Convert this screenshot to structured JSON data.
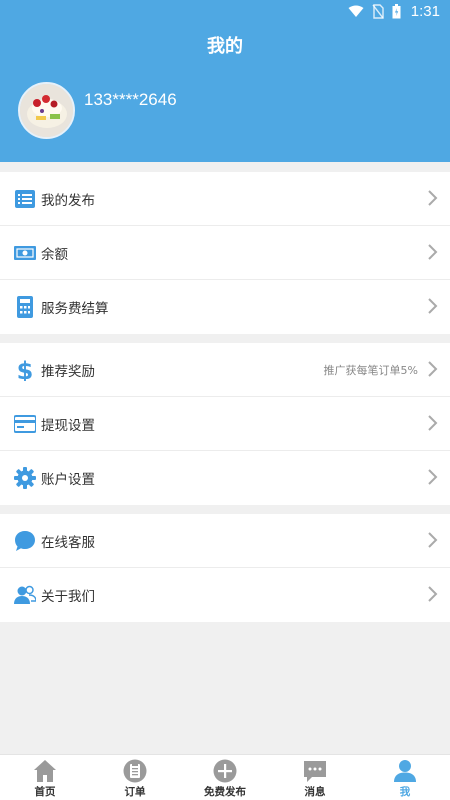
{
  "status_bar": {
    "time": "1:31"
  },
  "header": {
    "title": "我的",
    "phone": "133****2646"
  },
  "colors": {
    "primary": "#4fa8e3",
    "icon_blue": "#3f9ae0"
  },
  "groups": [
    {
      "items": [
        {
          "label": "我的发布",
          "icon": "list-icon"
        },
        {
          "label": "余额",
          "icon": "money-icon"
        },
        {
          "label": "服务费结算",
          "icon": "calculator-icon"
        }
      ]
    },
    {
      "items": [
        {
          "label": "推荐奖励",
          "icon": "dollar-icon",
          "hint": "推广获每笔订单5%"
        },
        {
          "label": "提现设置",
          "icon": "card-icon"
        },
        {
          "label": "账户设置",
          "icon": "gear-icon"
        }
      ]
    },
    {
      "items": [
        {
          "label": "在线客服",
          "icon": "chat-icon"
        },
        {
          "label": "关于我们",
          "icon": "users-icon"
        }
      ]
    }
  ],
  "tabbar": [
    {
      "label": "首页",
      "icon": "home-icon"
    },
    {
      "label": "订单",
      "icon": "order-icon"
    },
    {
      "label": "免费发布",
      "icon": "plus-icon"
    },
    {
      "label": "消息",
      "icon": "message-icon"
    },
    {
      "label": "我",
      "icon": "person-icon",
      "active": true
    }
  ]
}
